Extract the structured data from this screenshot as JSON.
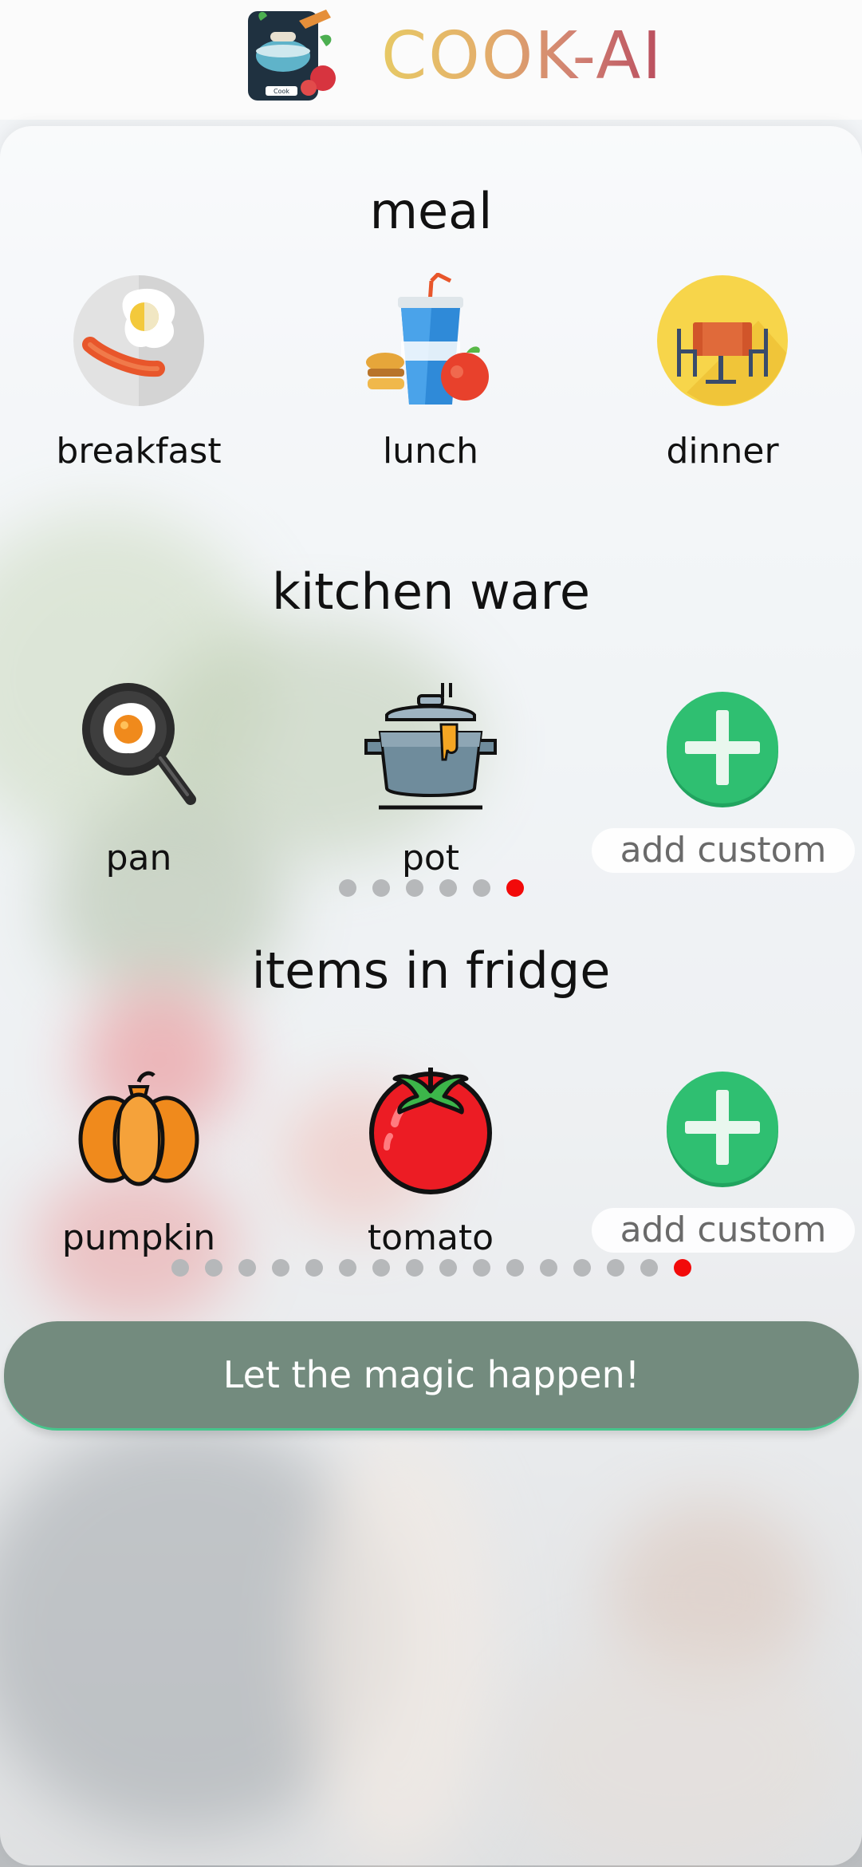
{
  "header": {
    "app_title": "COOK-AI",
    "logo_icon": "chef-pot-logo-icon"
  },
  "meal": {
    "title": "meal",
    "items": [
      {
        "label": "breakfast",
        "icon": "breakfast-plate-icon"
      },
      {
        "label": "lunch",
        "icon": "lunch-drink-burger-icon"
      },
      {
        "label": "dinner",
        "icon": "dinner-table-icon"
      }
    ]
  },
  "kitchen_ware": {
    "title": "kitchen ware",
    "items": [
      {
        "label": "pan",
        "icon": "frying-pan-icon"
      },
      {
        "label": "pot",
        "icon": "cooking-pot-icon"
      },
      {
        "label": "add custom",
        "icon": "add-icon"
      }
    ],
    "pages": 6,
    "active_page": 6
  },
  "fridge": {
    "title": "items in fridge",
    "items": [
      {
        "label": "pumpkin",
        "icon": "pumpkin-icon"
      },
      {
        "label": "tomato",
        "icon": "tomato-icon"
      },
      {
        "label": "add custom",
        "icon": "add-icon"
      }
    ],
    "pages": 16,
    "active_page": 16
  },
  "action": {
    "button_label": "Let the magic happen!"
  },
  "colors": {
    "accent_green": "#2fbf71",
    "button_bg": "#738b7e",
    "active_dot": "#f20a0a",
    "inactive_dot": "#b6b8ba"
  }
}
